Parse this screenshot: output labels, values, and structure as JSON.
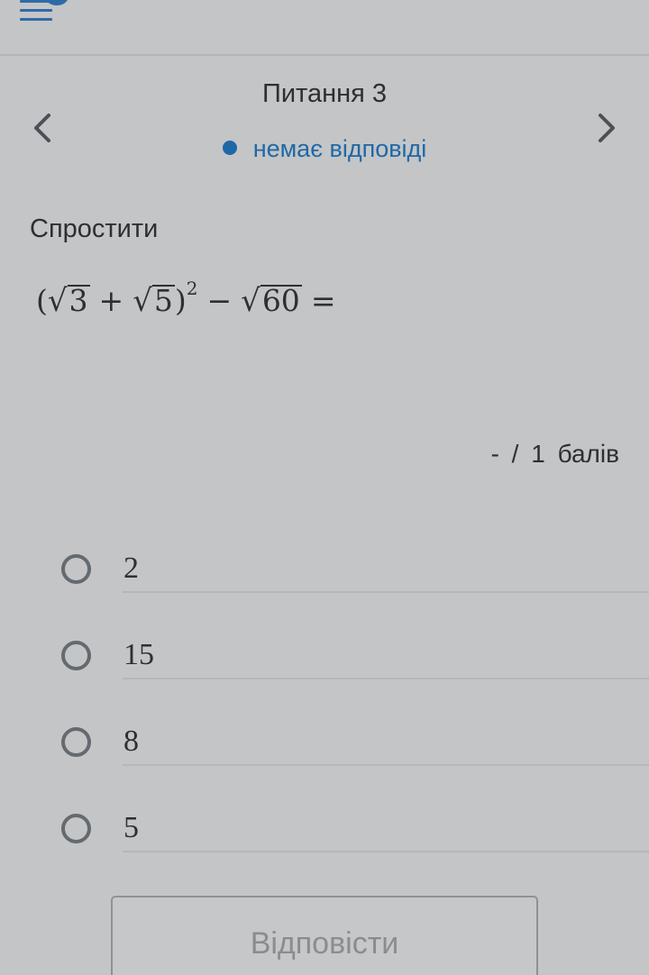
{
  "header": {
    "menu_icon": "menu-hamburger-icon"
  },
  "question_nav": {
    "title": "Питання 3",
    "status": "немає відповіді",
    "prev_icon": "chevron-left-icon",
    "next_icon": "chevron-right-icon",
    "status_color": "#1f68a7"
  },
  "question": {
    "instruction": "Спростити",
    "formula": {
      "open_paren": "(",
      "term1": "3",
      "plus": "+",
      "term2": "5",
      "close_paren": ")",
      "exponent": "2",
      "minus": "−",
      "term3": "60",
      "equals": "="
    },
    "score": "- / 1 балів"
  },
  "options": [
    {
      "label": "2"
    },
    {
      "label": "15"
    },
    {
      "label": "8"
    },
    {
      "label": "5"
    }
  ],
  "actions": {
    "submit_label": "Відповісти"
  },
  "colors": {
    "background": "#c4c5c6",
    "accent": "#2f6aa8",
    "text": "#2d2f31"
  }
}
